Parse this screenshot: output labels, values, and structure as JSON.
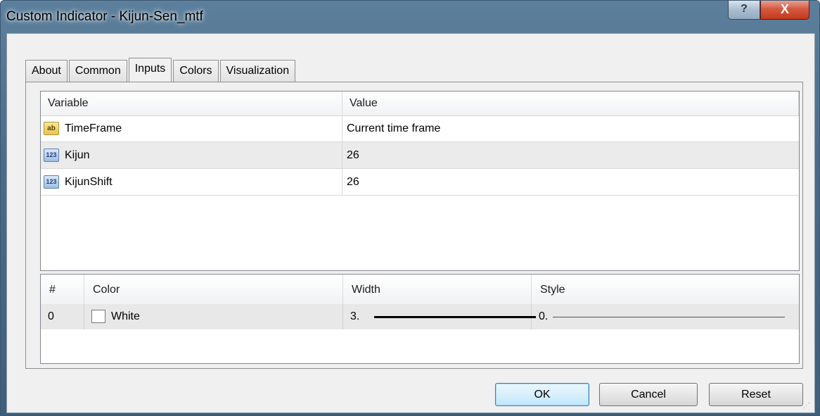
{
  "window": {
    "title": "Custom Indicator - Kijun-Sen_mtf",
    "help_label": "?",
    "close_label": "X"
  },
  "tabs": [
    {
      "label": "About",
      "active": false
    },
    {
      "label": "Common",
      "active": false
    },
    {
      "label": "Inputs",
      "active": true
    },
    {
      "label": "Colors",
      "active": false
    },
    {
      "label": "Visualization",
      "active": false
    }
  ],
  "inputs_table": {
    "headers": {
      "variable": "Variable",
      "value": "Value"
    },
    "rows": [
      {
        "icon": "string-ab-icon",
        "icon_text": "ab",
        "variable": "TimeFrame",
        "value": "Current time frame"
      },
      {
        "icon": "number-123-icon",
        "icon_text": "123",
        "variable": "Kijun",
        "value": "26"
      },
      {
        "icon": "number-123-icon",
        "icon_text": "123",
        "variable": "KijunShift",
        "value": "26"
      }
    ]
  },
  "styles_table": {
    "headers": {
      "index": "#",
      "color": "Color",
      "width": "Width",
      "style": "Style"
    },
    "rows": [
      {
        "index": "0",
        "color": "White",
        "color_hex": "#ffffff",
        "width": "3.",
        "style": "0."
      }
    ]
  },
  "buttons": {
    "ok": "OK",
    "cancel": "Cancel",
    "reset": "Reset"
  }
}
